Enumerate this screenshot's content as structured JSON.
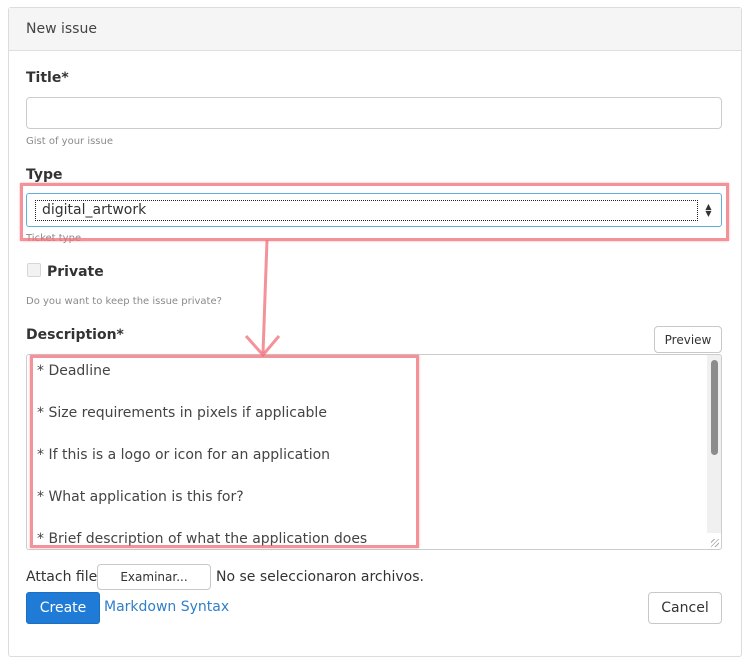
{
  "header": {
    "title": "New issue"
  },
  "form": {
    "title_label": "Title*",
    "title_value": "",
    "title_help": "Gist of your issue",
    "type_label": "Type",
    "type_value": "digital_artwork",
    "type_help": "Ticket type",
    "private_label": "Private",
    "private_checked": false,
    "private_help": "Do you want to keep the issue private?",
    "description_label": "Description*",
    "preview_label": "Preview",
    "description_lines": [
      "* Deadline",
      "",
      "* Size requirements in pixels if applicable",
      "",
      "* If this is a logo or icon for an application",
      "",
      "* What application is this for?",
      "",
      "* Brief description of what the application does"
    ],
    "attach_label": "Attach file",
    "browse_label": "Examinar...",
    "no_file_text": "No se seleccionaron archivos.",
    "create_label": "Create",
    "markdown_link": "Markdown Syntax",
    "cancel_label": "Cancel"
  },
  "annotation_color": "#f06e78"
}
